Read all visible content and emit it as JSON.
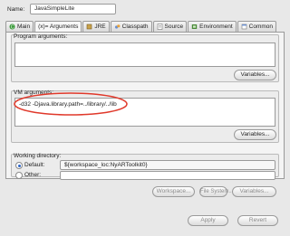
{
  "header": {
    "name_label": "Name:",
    "name_value": "JavaSimpleLite"
  },
  "tabs": [
    {
      "label": "Main",
      "icon": "main-icon",
      "active": false
    },
    {
      "label": "(x)= Arguments",
      "icon": "arguments-icon",
      "active": true
    },
    {
      "label": "JRE",
      "icon": "jre-icon",
      "active": false
    },
    {
      "label": "Classpath",
      "icon": "classpath-icon",
      "active": false
    },
    {
      "label": "Source",
      "icon": "source-icon",
      "active": false
    },
    {
      "label": "Environment",
      "icon": "environment-icon",
      "active": false
    },
    {
      "label": "Common",
      "icon": "common-icon",
      "active": false
    }
  ],
  "program_arguments": {
    "title": "Program arguments:",
    "value": "",
    "variables_label": "Variables..."
  },
  "vm_arguments": {
    "title": "VM arguments:",
    "value": "-d32 -Djava.library.path=../library/../lib",
    "variables_label": "Variables...",
    "highlight_color": "#e0392b"
  },
  "working_directory": {
    "title": "Working directory:",
    "default_label": "Default:",
    "default_value": "${workspace_loc:NyARToolkit0}",
    "other_label": "Other:",
    "other_value": "",
    "workspace_label": "Workspace...",
    "filesystem_label": "File System...",
    "variables_label": "Variables..."
  },
  "footer": {
    "apply_label": "Apply",
    "revert_label": "Revert"
  },
  "colors": {
    "background": "#e8e8e8",
    "accent": "#2b63c6",
    "highlight": "#e0392b"
  }
}
